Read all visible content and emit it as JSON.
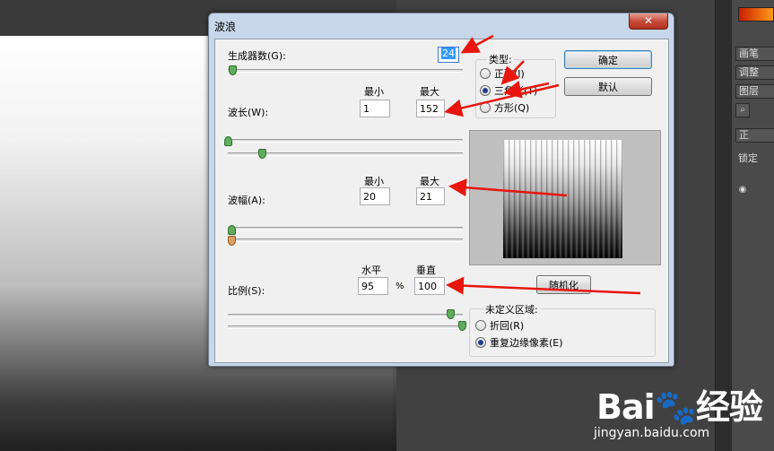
{
  "dialog": {
    "title": "波浪",
    "close_label": "✕",
    "generators_label": "生成器数(G):",
    "generators_value": "24",
    "wavelength_label": "波长(W):",
    "wavelength_min_header": "最小",
    "wavelength_max_header": "最大",
    "wavelength_min": "1",
    "wavelength_max": "152",
    "amplitude_label": "波幅(A):",
    "amplitude_min_header": "最小",
    "amplitude_max_header": "最大",
    "amplitude_min": "20",
    "amplitude_max": "21",
    "scale_label": "比例(S):",
    "scale_h_header": "水平",
    "scale_v_header": "垂直",
    "scale_h": "95",
    "scale_v": "100",
    "percent": "%",
    "type_group": "类型:",
    "type_options": [
      "正弦(I)",
      "三角形(T)",
      "方形(Q)"
    ],
    "type_selected": 1,
    "ok_label": "确定",
    "default_label": "默认",
    "randomize_label": "随机化",
    "undefined_group": "未定义区域:",
    "undefined_options": [
      "折回(R)",
      "重复边缘像素(E)"
    ],
    "undefined_selected": 1
  },
  "panels": {
    "tabs": [
      "画笔",
      "调整",
      "图层"
    ],
    "lock_label": "锁定",
    "normal_label": "正"
  },
  "watermark": {
    "logo": "Bai🐾经验",
    "url": "jingyan.baidu.com"
  },
  "colors": {
    "arrow": "#e8160c",
    "radio_dot": "#1f3d8a",
    "slider_thumb": "#5fae5b"
  }
}
